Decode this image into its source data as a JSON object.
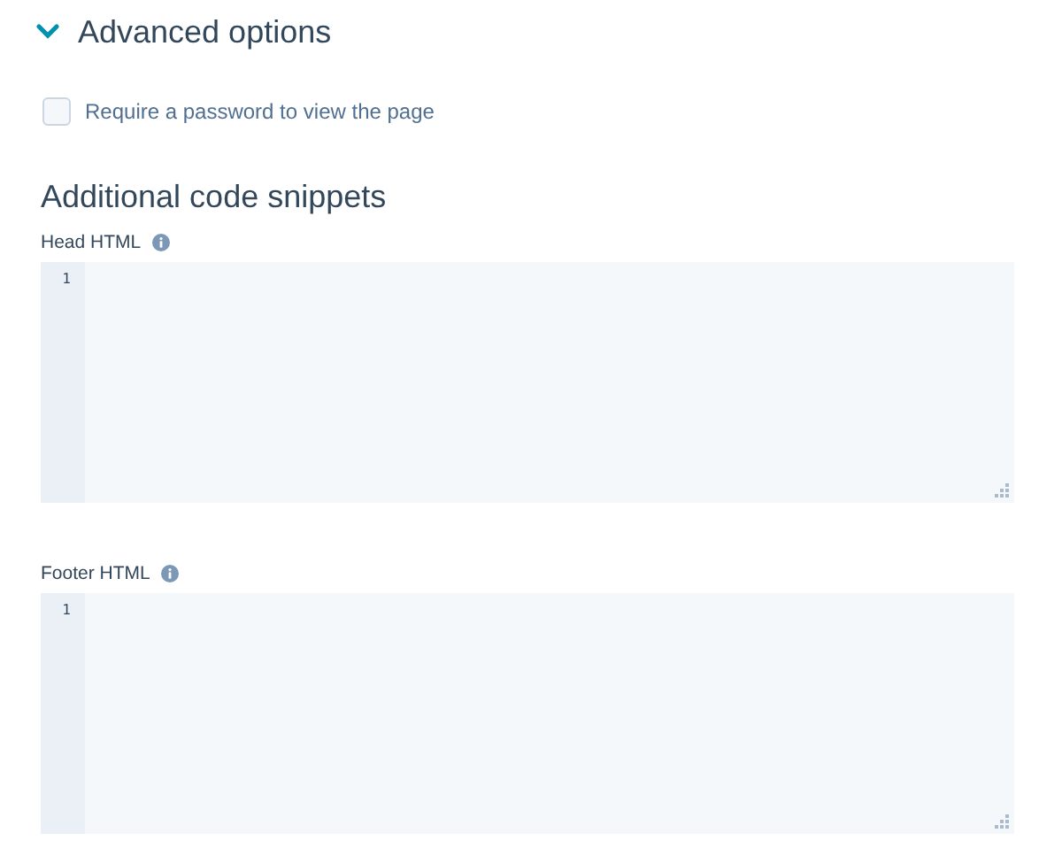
{
  "section": {
    "title": "Advanced options",
    "expanded": true
  },
  "password_option": {
    "label": "Require a password to view the page",
    "checked": false
  },
  "snippets": {
    "title": "Additional code snippets",
    "editors": [
      {
        "label": "Head HTML",
        "line_numbers": [
          "1"
        ]
      },
      {
        "label": "Footer HTML",
        "line_numbers": [
          "1"
        ]
      }
    ]
  }
}
